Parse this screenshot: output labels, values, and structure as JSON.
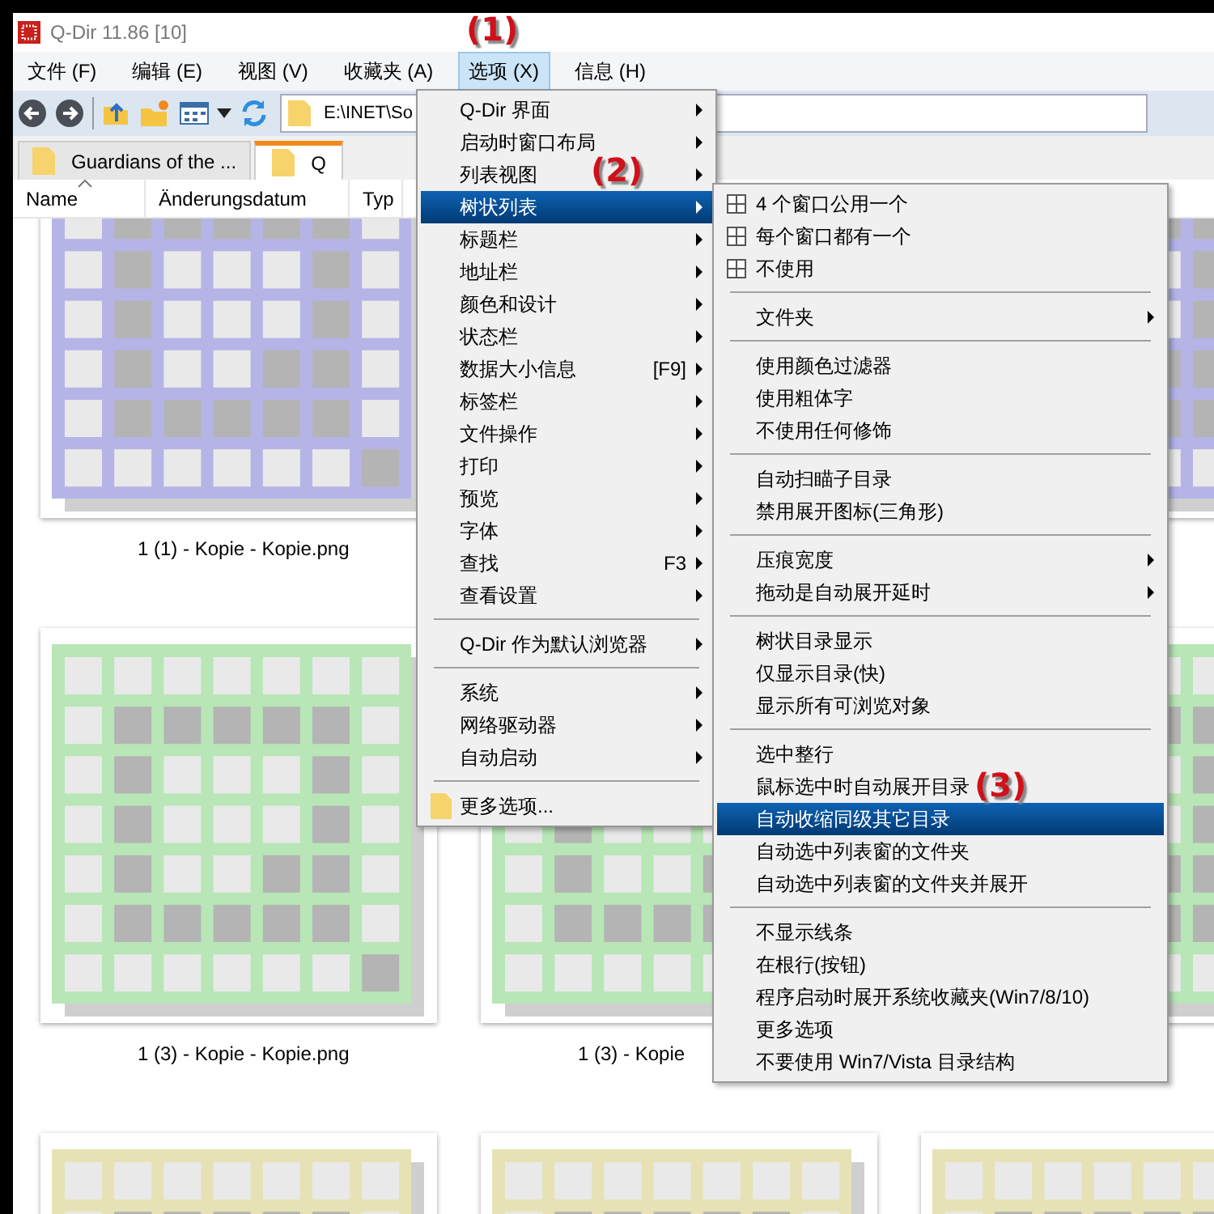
{
  "window": {
    "title": "Q-Dir 11.86 [10]"
  },
  "menu_bar": [
    {
      "label": "文件 (F)",
      "selected": false
    },
    {
      "label": "编辑 (E)",
      "selected": false
    },
    {
      "label": "视图 (V)",
      "selected": false
    },
    {
      "label": "收藏夹 (A)",
      "selected": false
    },
    {
      "label": "选项 (X)",
      "selected": true
    },
    {
      "label": "信息 (H)",
      "selected": false
    }
  ],
  "toolbar": {
    "address": "E:\\INET\\So"
  },
  "tabs": [
    {
      "label": "Guardians of the ...",
      "selected": false
    },
    {
      "label": "Q",
      "selected": true
    }
  ],
  "columns": [
    {
      "label": "Name",
      "sorted": true
    },
    {
      "label": "Änderungsdatum",
      "sorted": false
    },
    {
      "label": "Typ",
      "sorted": false
    }
  ],
  "files": [
    {
      "name": "1 (1) - Kopie - Kopie.png",
      "color": "#b6b4e6"
    },
    {
      "color": "#b6b4e6"
    },
    {
      "name": "1 (3) - Kopie - Kopie.png",
      "color": "#b8e6b6"
    },
    {
      "name": "1 (3) - Kopie",
      "color": "#b8e6b6"
    },
    {
      "color": "#b8e6b6"
    },
    {
      "color": "#e6e2b6"
    },
    {
      "color": "#e6e2b6"
    },
    {
      "color": "#e6e2b6"
    }
  ],
  "options_menu": {
    "items": [
      {
        "kind": "item",
        "label": "Q-Dir 界面",
        "submenu": true,
        "selected": false
      },
      {
        "kind": "item",
        "label": "启动时窗口布局",
        "submenu": true,
        "selected": false
      },
      {
        "kind": "item",
        "label": "列表视图",
        "submenu": true,
        "selected": false
      },
      {
        "kind": "item",
        "label": "树状列表",
        "submenu": true,
        "selected": true
      },
      {
        "kind": "item",
        "label": "标题栏",
        "submenu": true,
        "selected": false
      },
      {
        "kind": "item",
        "label": "地址栏",
        "submenu": true,
        "selected": false
      },
      {
        "kind": "item",
        "label": "颜色和设计",
        "submenu": true,
        "selected": false
      },
      {
        "kind": "item",
        "label": "状态栏",
        "submenu": true,
        "selected": false
      },
      {
        "kind": "item",
        "label": "数据大小信息",
        "shortcut": "[F9]",
        "submenu": true,
        "selected": false
      },
      {
        "kind": "item",
        "label": "标签栏",
        "submenu": true,
        "selected": false
      },
      {
        "kind": "item",
        "label": "文件操作",
        "submenu": true,
        "selected": false
      },
      {
        "kind": "item",
        "label": "打印",
        "submenu": true,
        "selected": false
      },
      {
        "kind": "item",
        "label": "预览",
        "submenu": true,
        "selected": false
      },
      {
        "kind": "item",
        "label": "字体",
        "submenu": true,
        "selected": false
      },
      {
        "kind": "item",
        "label": "查找",
        "shortcut": "F3",
        "submenu": true,
        "selected": false
      },
      {
        "kind": "item",
        "label": "查看设置",
        "submenu": true,
        "selected": false
      },
      {
        "kind": "separator"
      },
      {
        "kind": "item",
        "label": "Q-Dir 作为默认浏览器",
        "submenu": true,
        "selected": false
      },
      {
        "kind": "separator"
      },
      {
        "kind": "item",
        "label": "系统",
        "submenu": true,
        "selected": false
      },
      {
        "kind": "item",
        "label": "网络驱动器",
        "submenu": true,
        "selected": false
      },
      {
        "kind": "item",
        "label": "自动启动",
        "submenu": true,
        "selected": false
      },
      {
        "kind": "separator"
      },
      {
        "kind": "folder-item",
        "label": "更多选项...",
        "submenu": false,
        "selected": false
      }
    ]
  },
  "tree_submenu": {
    "items": [
      {
        "kind": "icon-item",
        "label": "4 个窗口公用一个",
        "submenu": false,
        "selected": false
      },
      {
        "kind": "icon-item",
        "label": "每个窗口都有一个",
        "submenu": false,
        "selected": false
      },
      {
        "kind": "icon-item",
        "label": "不使用",
        "submenu": false,
        "selected": false
      },
      {
        "kind": "separator"
      },
      {
        "kind": "item",
        "label": "文件夹",
        "submenu": true,
        "selected": false
      },
      {
        "kind": "separator"
      },
      {
        "kind": "item",
        "label": "使用颜色过滤器",
        "submenu": false,
        "selected": false
      },
      {
        "kind": "item",
        "label": "使用粗体字",
        "submenu": false,
        "selected": false
      },
      {
        "kind": "item",
        "label": "不使用任何修饰",
        "submenu": false,
        "selected": false
      },
      {
        "kind": "separator"
      },
      {
        "kind": "item",
        "label": "自动扫瞄子目录",
        "submenu": false,
        "selected": false
      },
      {
        "kind": "item",
        "label": "禁用展开图标(三角形)",
        "submenu": false,
        "selected": false
      },
      {
        "kind": "separator"
      },
      {
        "kind": "item",
        "label": "压痕宽度",
        "submenu": true,
        "selected": false
      },
      {
        "kind": "item",
        "label": "拖动是自动展开延时",
        "submenu": true,
        "selected": false
      },
      {
        "kind": "separator"
      },
      {
        "kind": "item",
        "label": "树状目录显示",
        "submenu": false,
        "selected": false
      },
      {
        "kind": "item",
        "label": "仅显示目录(快)",
        "submenu": false,
        "selected": false
      },
      {
        "kind": "item",
        "label": "显示所有可浏览对象",
        "submenu": false,
        "selected": false
      },
      {
        "kind": "separator"
      },
      {
        "kind": "item",
        "label": "选中整行",
        "submenu": false,
        "selected": false
      },
      {
        "kind": "item",
        "label": "鼠标选中时自动展开目录",
        "submenu": false,
        "selected": false
      },
      {
        "kind": "item",
        "label": "自动收缩同级其它目录",
        "submenu": false,
        "selected": true
      },
      {
        "kind": "item",
        "label": "自动选中列表窗的文件夹",
        "submenu": false,
        "selected": false
      },
      {
        "kind": "item",
        "label": "自动选中列表窗的文件夹并展开",
        "submenu": false,
        "selected": false
      },
      {
        "kind": "separator"
      },
      {
        "kind": "item",
        "label": "不显示线条",
        "submenu": false,
        "selected": false
      },
      {
        "kind": "item",
        "label": "在根行(按钮)",
        "submenu": false,
        "selected": false
      },
      {
        "kind": "item",
        "label": "程序启动时展开系统收藏夹(Win7/8/10)",
        "submenu": false,
        "selected": false
      },
      {
        "kind": "item",
        "label": "更多选项",
        "submenu": false,
        "selected": false
      },
      {
        "kind": "item",
        "label": "不要使用 Win7/Vista 目录结构",
        "submenu": false,
        "selected": false
      }
    ]
  },
  "annotations": [
    {
      "text": "(1)"
    },
    {
      "text": "(2)"
    },
    {
      "text": "(3)"
    }
  ]
}
